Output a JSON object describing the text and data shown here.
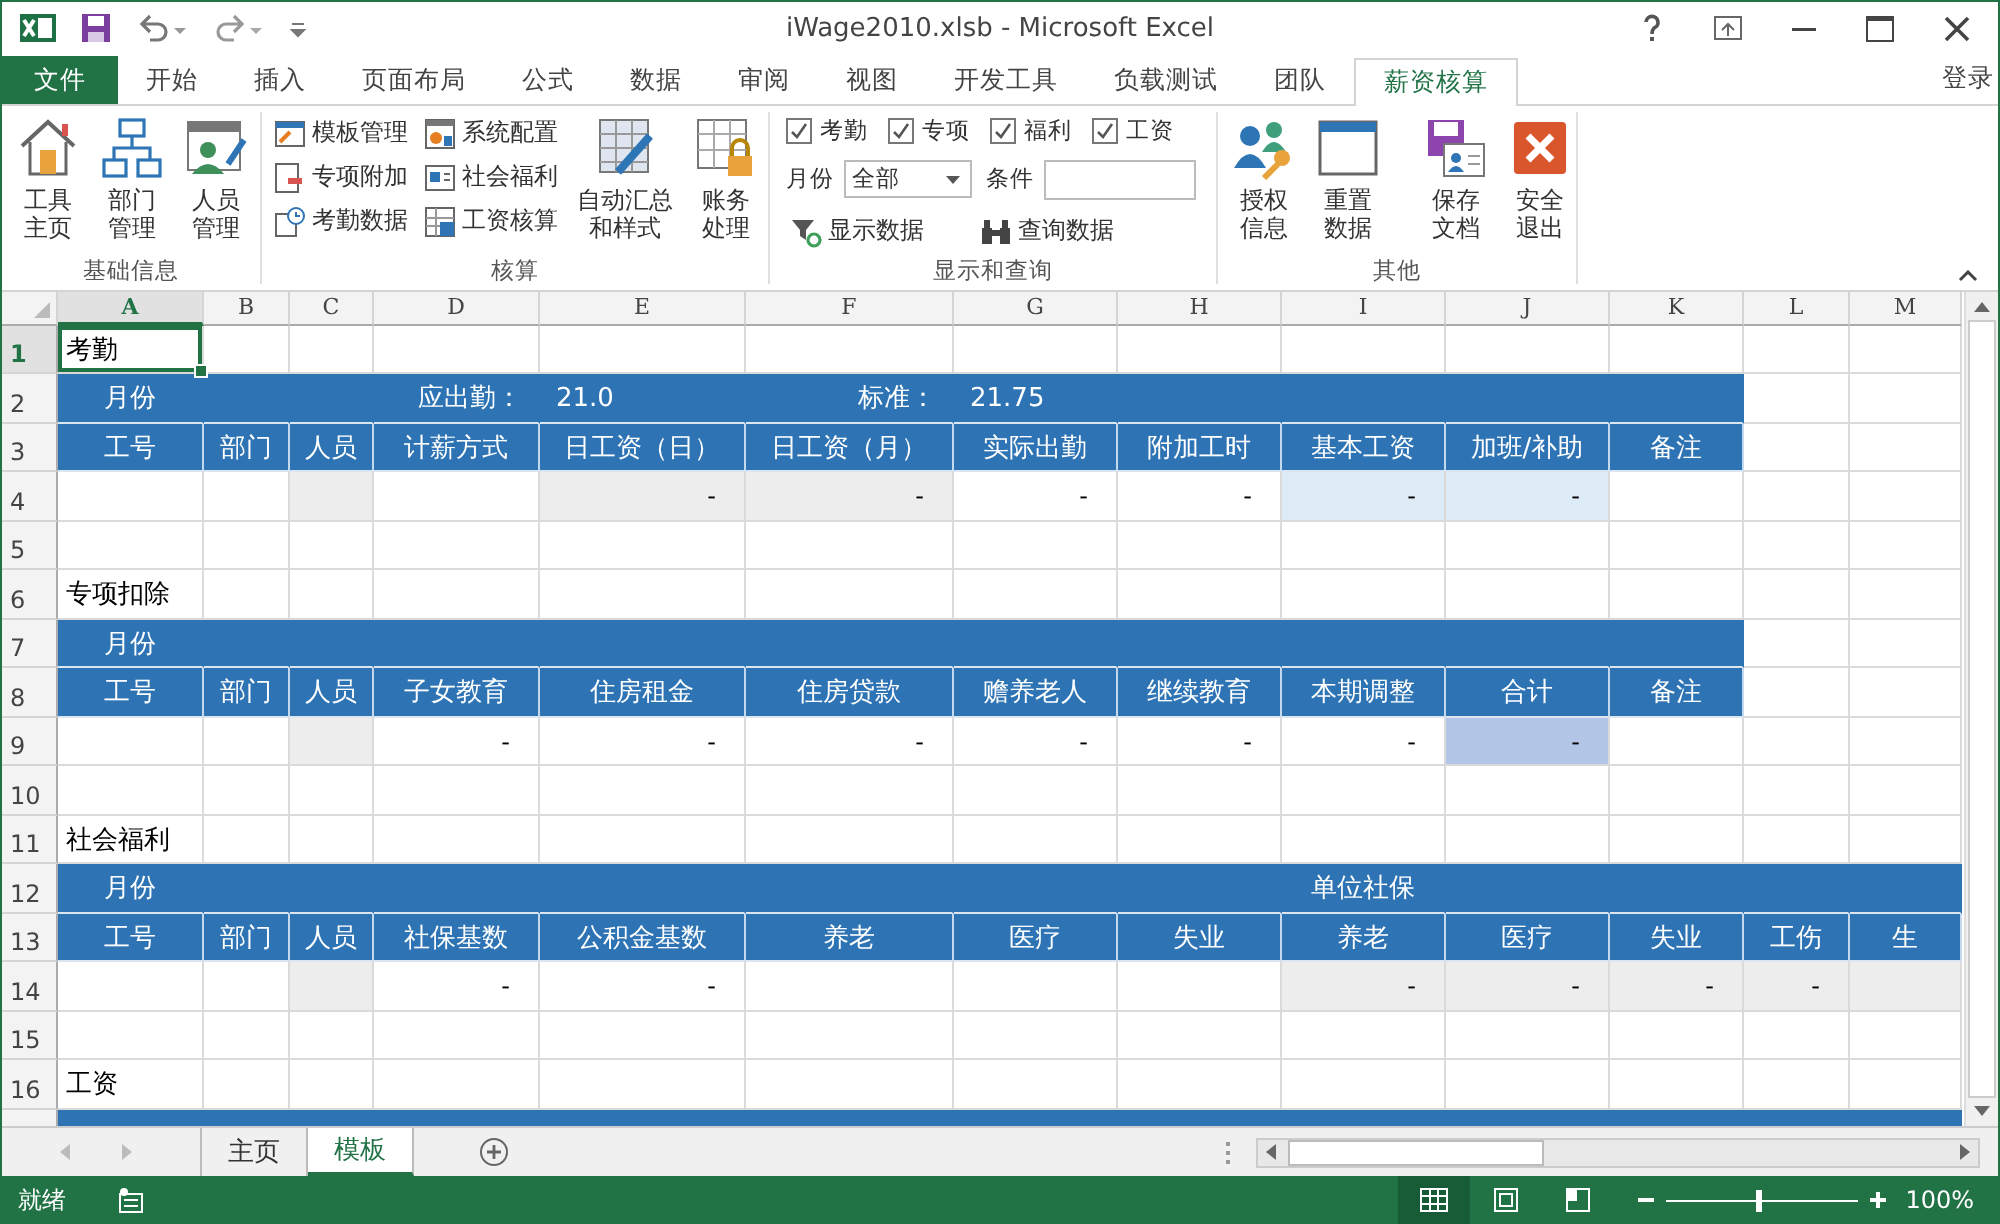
{
  "window": {
    "title": "iWage2010.xlsb - Microsoft Excel"
  },
  "ribbon_tabs": [
    {
      "label": "文件",
      "kind": "file",
      "selected": false
    },
    {
      "label": "开始",
      "kind": "tab",
      "selected": false
    },
    {
      "label": "插入",
      "kind": "tab",
      "selected": false
    },
    {
      "label": "页面布局",
      "kind": "tab",
      "selected": false
    },
    {
      "label": "公式",
      "kind": "tab",
      "selected": false
    },
    {
      "label": "数据",
      "kind": "tab",
      "selected": false
    },
    {
      "label": "审阅",
      "kind": "tab",
      "selected": false
    },
    {
      "label": "视图",
      "kind": "tab",
      "selected": false
    },
    {
      "label": "开发工具",
      "kind": "tab",
      "selected": false
    },
    {
      "label": "负载测试",
      "kind": "tab",
      "selected": false
    },
    {
      "label": "团队",
      "kind": "tab",
      "selected": false
    },
    {
      "label": "薪资核算",
      "kind": "tab",
      "selected": true
    }
  ],
  "sign_in": "登录",
  "ribbon": {
    "basic_info": {
      "caption": "基础信息",
      "buttons": [
        "工具主页",
        "部门管理",
        "人员管理"
      ]
    },
    "accounting": {
      "caption": "核算",
      "small_buttons": [
        "模板管理",
        "专项附加",
        "考勤数据",
        "系统配置",
        "社会福利",
        "工资核算"
      ],
      "large_buttons": [
        "自动汇总和样式",
        "账务处理"
      ]
    },
    "display_query": {
      "caption": "显示和查询",
      "filters": [
        {
          "label": "考勤",
          "checked": true
        },
        {
          "label": "专项",
          "checked": true
        },
        {
          "label": "福利",
          "checked": true
        },
        {
          "label": "工资",
          "checked": true
        }
      ],
      "month": {
        "label": "月份",
        "value": "全部"
      },
      "condition": {
        "label": "条件"
      },
      "actions": [
        "显示数据",
        "查询数据"
      ]
    },
    "other": {
      "caption": "其他",
      "buttons": [
        "授权信息",
        "重置数据",
        "保存文档",
        "安全退出"
      ]
    }
  },
  "sheet": {
    "columns": [
      {
        "label": "A",
        "selected": true
      },
      {
        "label": "B",
        "selected": false
      },
      {
        "label": "C",
        "selected": false
      },
      {
        "label": "D",
        "selected": false
      },
      {
        "label": "E",
        "selected": false
      },
      {
        "label": "F",
        "selected": false
      },
      {
        "label": "G",
        "selected": false
      },
      {
        "label": "H",
        "selected": false
      },
      {
        "label": "I",
        "selected": false
      },
      {
        "label": "J",
        "selected": false
      },
      {
        "label": "K",
        "selected": false
      },
      {
        "label": "L",
        "selected": false
      },
      {
        "label": "M",
        "selected": false
      }
    ],
    "rows": [
      {
        "number": "1",
        "selected": true,
        "cells": [
          {
            "kind": "title",
            "text": "考勤",
            "selected": true
          }
        ]
      },
      {
        "number": "2",
        "selected": false,
        "cells": [
          {
            "kind": "band-caption",
            "text": "月份"
          },
          {
            "kind": "band"
          },
          {
            "kind": "band"
          },
          {
            "kind": "band-label",
            "text": "应出勤："
          },
          {
            "kind": "band-value",
            "text": "21.0"
          },
          {
            "kind": "band-label",
            "text": "标准："
          },
          {
            "kind": "band-value",
            "text": "21.75"
          },
          {
            "kind": "band"
          },
          {
            "kind": "band"
          },
          {
            "kind": "band"
          },
          {
            "kind": "band"
          }
        ]
      },
      {
        "number": "3",
        "selected": false,
        "cells": [
          {
            "kind": "header",
            "text": "工号"
          },
          {
            "kind": "header",
            "text": "部门"
          },
          {
            "kind": "header",
            "text": "人员"
          },
          {
            "kind": "header",
            "text": "计薪方式"
          },
          {
            "kind": "header",
            "text": "日工资（日）"
          },
          {
            "kind": "header",
            "text": "日工资（月）"
          },
          {
            "kind": "header",
            "text": "实际出勤"
          },
          {
            "kind": "header",
            "text": "附加工时"
          },
          {
            "kind": "header",
            "text": "基本工资"
          },
          {
            "kind": "header",
            "text": "加班/补助"
          },
          {
            "kind": "header",
            "text": "备注"
          }
        ]
      },
      {
        "number": "4",
        "selected": false,
        "cells": [
          {
            "kind": "blank"
          },
          {
            "kind": "blank"
          },
          {
            "kind": "shaded"
          },
          {
            "kind": "blank"
          },
          {
            "kind": "shaded",
            "text": "-"
          },
          {
            "kind": "shaded",
            "text": "-"
          },
          {
            "kind": "blank",
            "text": "-"
          },
          {
            "kind": "blank",
            "text": "-"
          },
          {
            "kind": "tinted",
            "text": "-"
          },
          {
            "kind": "tinted",
            "text": "-"
          }
        ]
      },
      {
        "number": "5",
        "selected": false,
        "cells": []
      },
      {
        "number": "6",
        "selected": false,
        "cells": [
          {
            "kind": "title",
            "text": "专项扣除"
          }
        ]
      },
      {
        "number": "7",
        "selected": false,
        "cells": [
          {
            "kind": "band-caption",
            "text": "月份"
          },
          {
            "kind": "band"
          },
          {
            "kind": "band"
          },
          {
            "kind": "band"
          },
          {
            "kind": "band"
          },
          {
            "kind": "band"
          },
          {
            "kind": "band"
          },
          {
            "kind": "band"
          },
          {
            "kind": "band"
          },
          {
            "kind": "band"
          },
          {
            "kind": "band"
          }
        ]
      },
      {
        "number": "8",
        "selected": false,
        "cells": [
          {
            "kind": "header",
            "text": "工号"
          },
          {
            "kind": "header",
            "text": "部门"
          },
          {
            "kind": "header",
            "text": "人员"
          },
          {
            "kind": "header",
            "text": "子女教育"
          },
          {
            "kind": "header",
            "text": "住房租金"
          },
          {
            "kind": "header",
            "text": "住房贷款"
          },
          {
            "kind": "header",
            "text": "赡养老人"
          },
          {
            "kind": "header",
            "text": "继续教育"
          },
          {
            "kind": "header",
            "text": "本期调整"
          },
          {
            "kind": "header",
            "text": "合计"
          },
          {
            "kind": "header",
            "text": "备注"
          }
        ]
      },
      {
        "number": "9",
        "selected": false,
        "cells": [
          {
            "kind": "blank"
          },
          {
            "kind": "blank"
          },
          {
            "kind": "shaded"
          },
          {
            "kind": "blank",
            "text": "-"
          },
          {
            "kind": "blank",
            "text": "-"
          },
          {
            "kind": "blank",
            "text": "-"
          },
          {
            "kind": "blank",
            "text": "-"
          },
          {
            "kind": "blank",
            "text": "-"
          },
          {
            "kind": "blank",
            "text": "-"
          },
          {
            "kind": "accent",
            "text": "-"
          }
        ]
      },
      {
        "number": "10",
        "selected": false,
        "cells": []
      },
      {
        "number": "11",
        "selected": false,
        "cells": [
          {
            "kind": "title",
            "text": "社会福利"
          }
        ]
      },
      {
        "number": "12",
        "selected": false,
        "cells": [
          {
            "kind": "band-caption",
            "text": "月份"
          },
          {
            "kind": "band"
          },
          {
            "kind": "band"
          },
          {
            "kind": "band"
          },
          {
            "kind": "band"
          },
          {
            "kind": "band"
          },
          {
            "kind": "band"
          },
          {
            "kind": "band"
          },
          {
            "kind": "band-caption",
            "text": "单位社保"
          },
          {
            "kind": "band"
          },
          {
            "kind": "band"
          },
          {
            "kind": "band"
          },
          {
            "kind": "band"
          }
        ]
      },
      {
        "number": "13",
        "selected": false,
        "cells": [
          {
            "kind": "header",
            "text": "工号"
          },
          {
            "kind": "header",
            "text": "部门"
          },
          {
            "kind": "header",
            "text": "人员"
          },
          {
            "kind": "header",
            "text": "社保基数"
          },
          {
            "kind": "header",
            "text": "公积金基数"
          },
          {
            "kind": "header",
            "text": "养老"
          },
          {
            "kind": "header",
            "text": "医疗"
          },
          {
            "kind": "header",
            "text": "失业"
          },
          {
            "kind": "header",
            "text": "养老"
          },
          {
            "kind": "header",
            "text": "医疗"
          },
          {
            "kind": "header",
            "text": "失业"
          },
          {
            "kind": "header",
            "text": "工伤"
          },
          {
            "kind": "header",
            "text": "生"
          }
        ]
      },
      {
        "number": "14",
        "selected": false,
        "cells": [
          {
            "kind": "blank"
          },
          {
            "kind": "blank"
          },
          {
            "kind": "shaded"
          },
          {
            "kind": "blank",
            "text": "-"
          },
          {
            "kind": "blank",
            "text": "-"
          },
          {
            "kind": "blank"
          },
          {
            "kind": "blank"
          },
          {
            "kind": "blank"
          },
          {
            "kind": "shaded",
            "text": "-"
          },
          {
            "kind": "shaded",
            "text": "-"
          },
          {
            "kind": "shaded",
            "text": "-"
          },
          {
            "kind": "shaded",
            "text": "-"
          },
          {
            "kind": "shaded"
          }
        ]
      },
      {
        "number": "15",
        "selected": false,
        "cells": []
      },
      {
        "number": "16",
        "selected": false,
        "cells": [
          {
            "kind": "title",
            "text": "工资"
          }
        ]
      },
      {
        "selected": false,
        "cells": [
          {
            "kind": "band"
          },
          {
            "kind": "band"
          },
          {
            "kind": "band"
          },
          {
            "kind": "band"
          },
          {
            "kind": "band"
          },
          {
            "kind": "band"
          },
          {
            "kind": "band"
          },
          {
            "kind": "band"
          },
          {
            "kind": "band"
          },
          {
            "kind": "band"
          },
          {
            "kind": "band"
          },
          {
            "kind": "band"
          },
          {
            "kind": "band"
          }
        ]
      }
    ]
  },
  "sheet_tabs": [
    {
      "label": "主页",
      "selected": false
    },
    {
      "label": "模板",
      "selected": true
    }
  ],
  "status_bar": {
    "text": "就绪",
    "views": [
      {
        "selected": true
      },
      {
        "selected": false
      },
      {
        "selected": false
      }
    ],
    "zoom": {
      "level": 0.48,
      "reading": "100%"
    }
  }
}
